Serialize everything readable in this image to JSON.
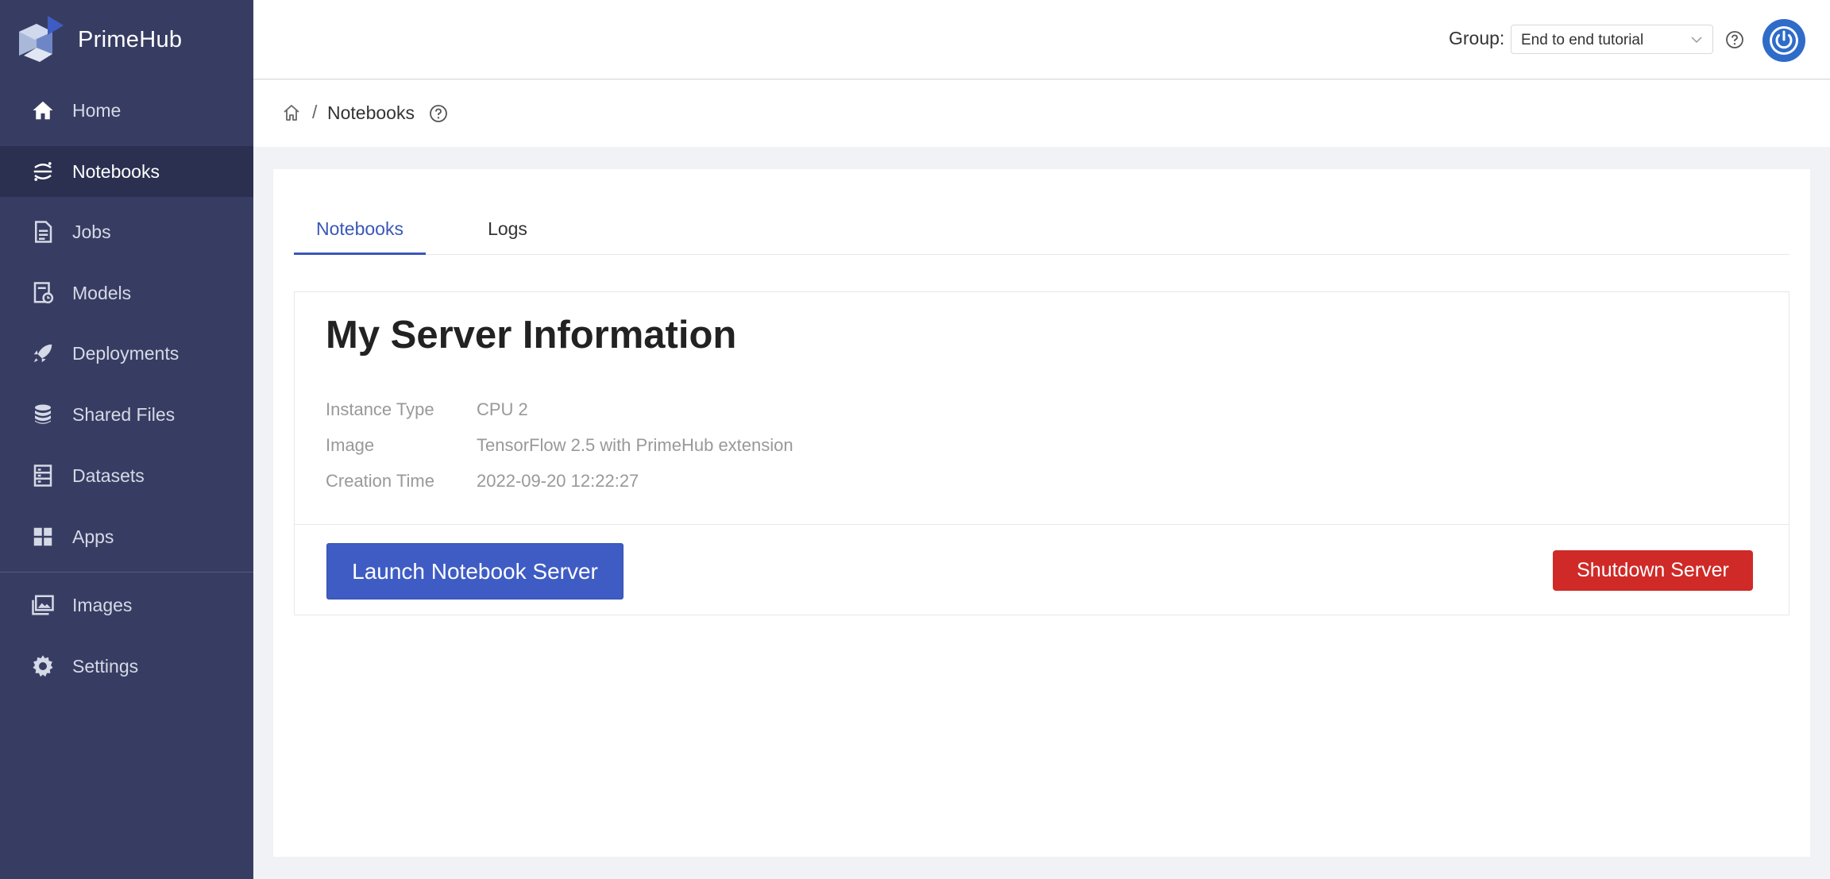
{
  "app": {
    "name": "PrimeHub"
  },
  "sidebar": {
    "items": [
      {
        "label": "Home",
        "icon": "home-icon"
      },
      {
        "label": "Notebooks",
        "icon": "jupyter-icon",
        "active": true
      },
      {
        "label": "Jobs",
        "icon": "jobs-icon"
      },
      {
        "label": "Models",
        "icon": "models-icon"
      },
      {
        "label": "Deployments",
        "icon": "rocket-icon"
      },
      {
        "label": "Shared Files",
        "icon": "database-icon"
      },
      {
        "label": "Datasets",
        "icon": "datasets-icon"
      },
      {
        "label": "Apps",
        "icon": "apps-icon"
      },
      {
        "label": "Images",
        "icon": "image-icon"
      },
      {
        "label": "Settings",
        "icon": "gear-icon"
      }
    ]
  },
  "header": {
    "group_label": "Group:",
    "group_value": "End to end tutorial"
  },
  "breadcrumb": {
    "separator": "/",
    "current": "Notebooks"
  },
  "tabs": [
    {
      "label": "Notebooks",
      "active": true
    },
    {
      "label": "Logs",
      "active": false
    }
  ],
  "server_info": {
    "title": "My Server Information",
    "rows": [
      {
        "key": "Instance Type",
        "value": "CPU 2"
      },
      {
        "key": "Image",
        "value": "TensorFlow 2.5 with PrimeHub extension"
      },
      {
        "key": "Creation Time",
        "value": "2022-09-20 12:22:27"
      }
    ],
    "launch_label": "Launch Notebook Server",
    "shutdown_label": "Shutdown Server"
  },
  "colors": {
    "sidebar_bg": "#373d62",
    "accent": "#3f5cc4",
    "danger": "#cf2a27",
    "power": "#2f6cc9"
  }
}
